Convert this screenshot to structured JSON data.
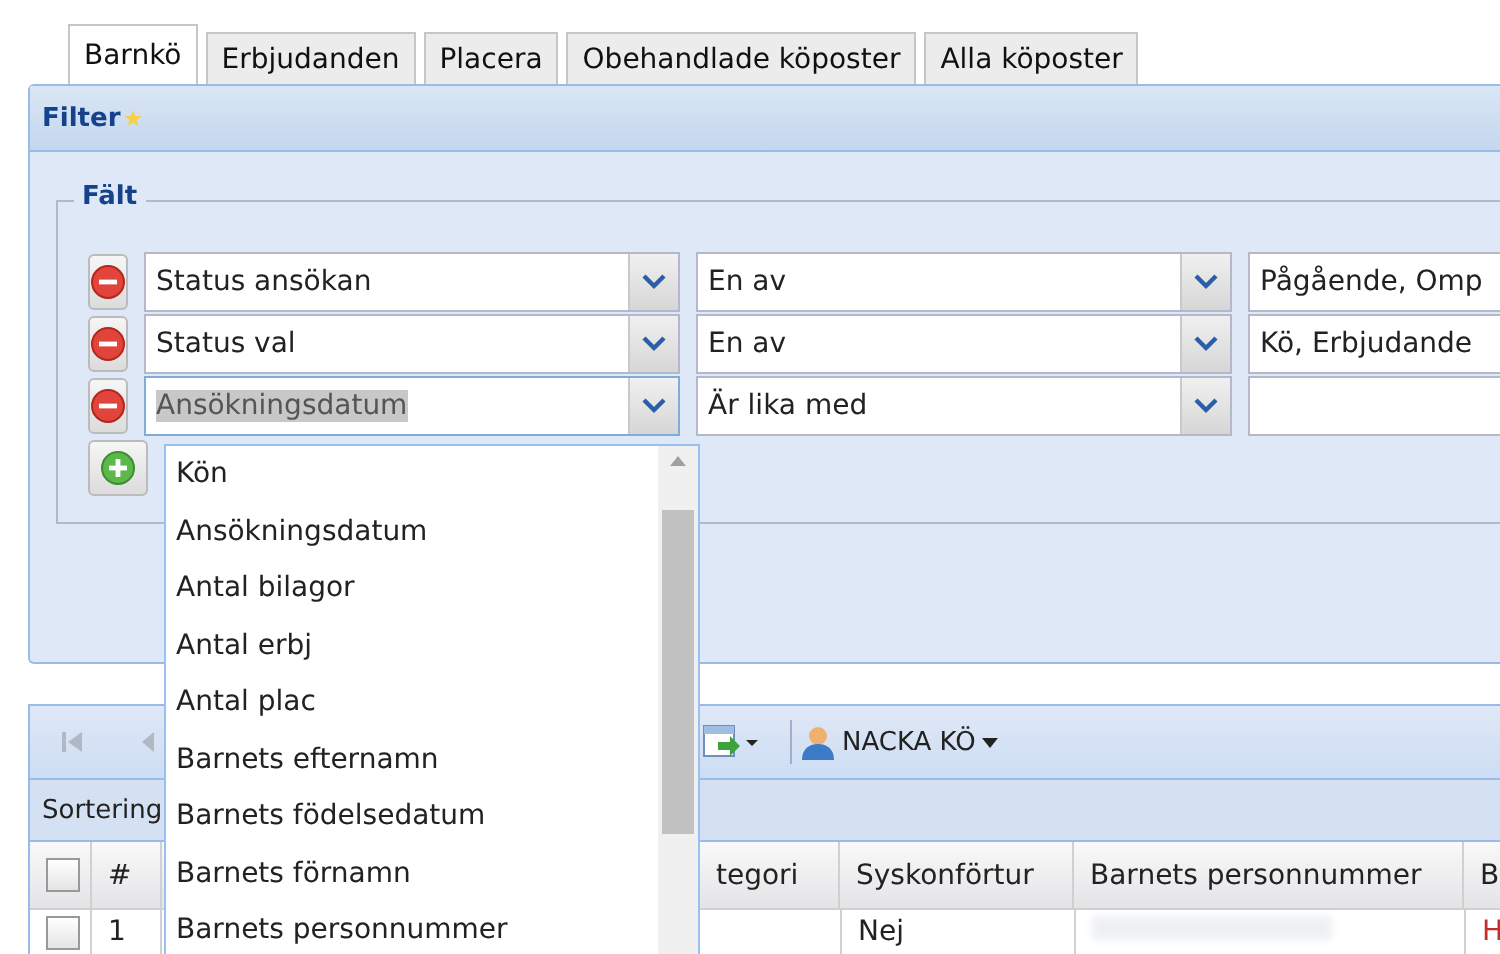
{
  "tabs": [
    {
      "label": "Barnkö",
      "selected": true
    },
    {
      "label": "Erbjudanden",
      "selected": false
    },
    {
      "label": "Placera",
      "selected": false
    },
    {
      "label": "Obehandlade köposter",
      "selected": false
    },
    {
      "label": "Alla köposter",
      "selected": false
    }
  ],
  "filter": {
    "title": "Filter",
    "fieldset": "Fält",
    "rows": [
      {
        "field": "Status ansökan",
        "operator": "En av",
        "value": "Pågående, Omp",
        "focused": false
      },
      {
        "field": "Status val",
        "operator": "En av",
        "value": "Kö, Erbjudande",
        "focused": false
      },
      {
        "field": "Ansökningsdatum",
        "operator": "Är lika med",
        "focused": true
      }
    ]
  },
  "dropdown": {
    "items": [
      "Kön",
      "Ansökningsdatum",
      "Antal bilagor",
      "Antal erbj",
      "Antal plac",
      "Barnets efternamn",
      "Barnets födelsedatum",
      "Barnets förnamn",
      "Barnets personnummer"
    ]
  },
  "grid": {
    "user": "NACKA KÖ",
    "sort_label": "Sortering",
    "header_checked": false,
    "columns": [
      "#",
      "tegori",
      "Syskonförtur",
      "Barnets personnummer",
      "B"
    ],
    "rows": [
      {
        "number": "1",
        "sibling_priority": "Nej",
        "column_b": "H",
        "checked": false
      }
    ]
  }
}
